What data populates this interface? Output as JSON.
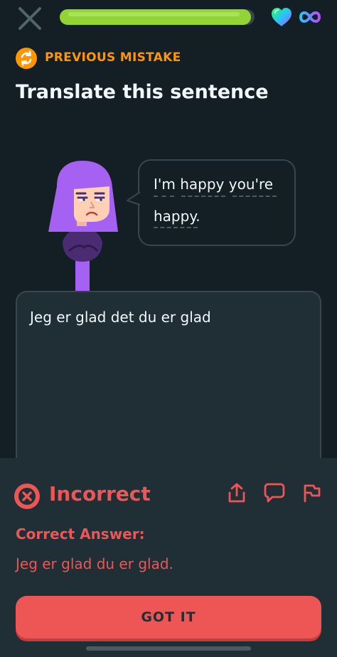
{
  "header": {
    "close_icon": "close-icon",
    "progress": 0.98,
    "hearts_icon": "heart-icon",
    "infinity_icon": "infinity-icon"
  },
  "banner": {
    "icon": "refresh-icon",
    "label": "PREVIOUS MISTAKE"
  },
  "prompt": {
    "title": "Translate this sentence",
    "sentence_line1": "I'm happy you're",
    "sentence_line2": "happy."
  },
  "answer": {
    "value": "Jeg er glad det du er glad"
  },
  "feedback": {
    "status": "Incorrect",
    "status_icon": "x-circle-icon",
    "correct_heading": "Correct Answer:",
    "correct_answer": "Jeg er glad du er glad.",
    "continue_label": "GOT IT",
    "action_icons": [
      "share-icon",
      "comment-icon",
      "flag-icon"
    ]
  },
  "colors": {
    "background": "#131f24",
    "panel": "#202f36",
    "accent_green": "#93d333",
    "accent_orange": "#ff9600",
    "error_red": "#ee5555",
    "character_purple": "#a561f1"
  }
}
